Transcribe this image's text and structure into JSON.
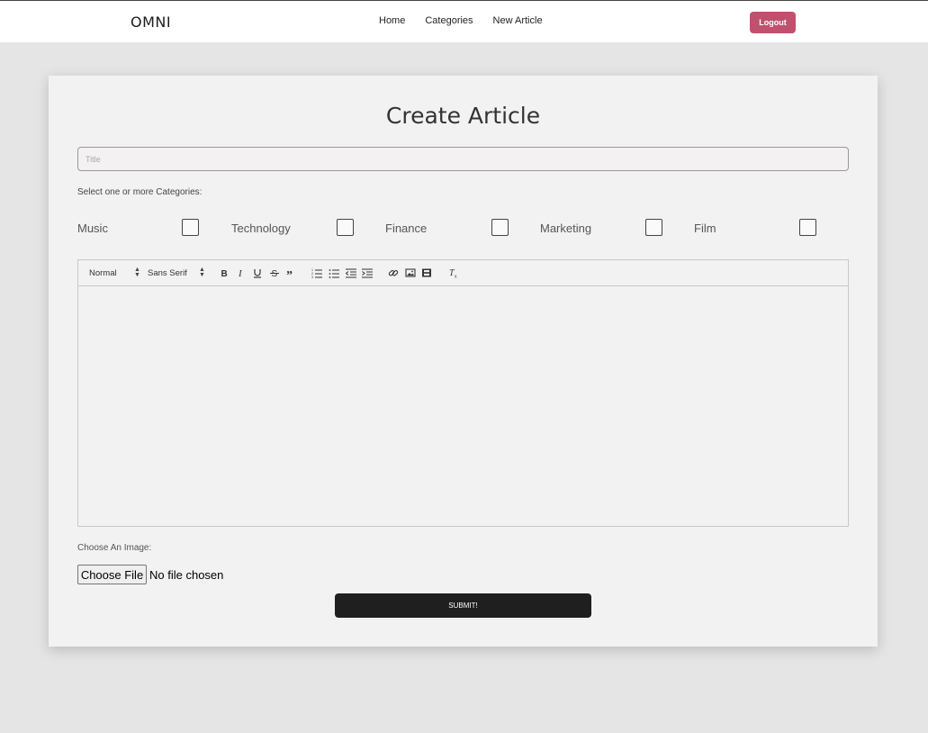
{
  "nav": {
    "brand": "OMNI",
    "links": [
      "Home",
      "Categories",
      "New Article"
    ],
    "logout_label": "Logout",
    "logout_color": "#c0506e"
  },
  "form": {
    "heading": "Create Article",
    "title_placeholder": "Title",
    "categories_label": "Select one or more Categories:",
    "categories": [
      {
        "label": "Music",
        "checked": false
      },
      {
        "label": "Technology",
        "checked": false
      },
      {
        "label": "Finance",
        "checked": false
      },
      {
        "label": "Marketing",
        "checked": false
      },
      {
        "label": "Film",
        "checked": false
      }
    ],
    "toolbar": {
      "header_select": "Normal",
      "font_select": "Sans Serif",
      "buttons": [
        "bold-icon",
        "italic-icon",
        "underline-icon",
        "strike-icon",
        "blockquote-icon",
        "ordered-list-icon",
        "bullet-list-icon",
        "outdent-icon",
        "indent-icon",
        "link-icon",
        "image-icon",
        "video-icon",
        "clear-format-icon"
      ]
    },
    "image_label": "Choose An Image:",
    "file_button": "Choose File",
    "file_status": "No file chosen",
    "submit_label": "SUBMIT!"
  }
}
